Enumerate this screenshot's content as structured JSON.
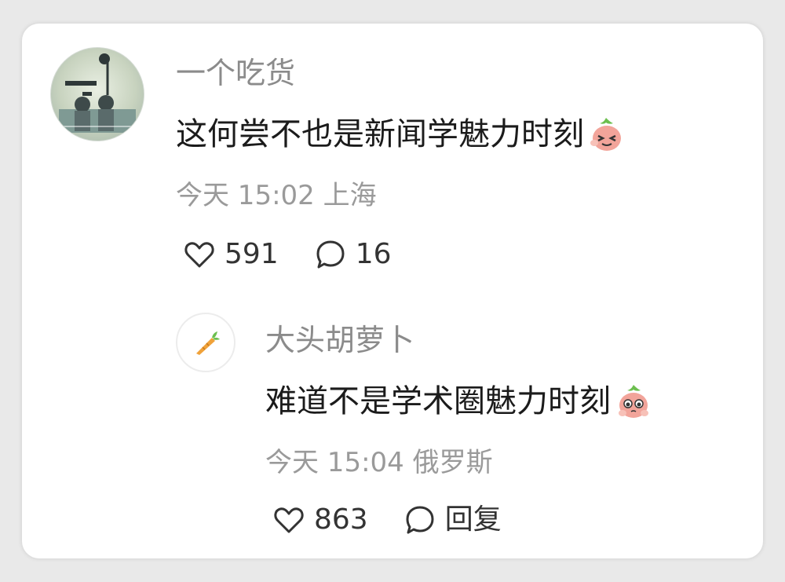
{
  "comments": [
    {
      "username": "一个吃货",
      "text": "这何尝不也是新闻学魅力时刻",
      "time": "今天 15:02",
      "location": "上海",
      "likes": "591",
      "replies": "16",
      "emoji": "carrot-wink-emoji-icon"
    }
  ],
  "reply": {
    "username": "大头胡萝卜",
    "text": "难道不是学术圈魅力时刻",
    "time": "今天 15:04",
    "location": "俄罗斯",
    "likes": "863",
    "reply_label": "回复",
    "emoji": "carrot-pleading-emoji-icon"
  },
  "colors": {
    "background": "#e9e9e9",
    "card": "#ffffff",
    "username": "#8b8b8b",
    "text": "#1b1b1b",
    "meta": "#9a9a9a",
    "emoji_pink": "#f2a49a",
    "carrot_orange": "#f0a23a"
  }
}
